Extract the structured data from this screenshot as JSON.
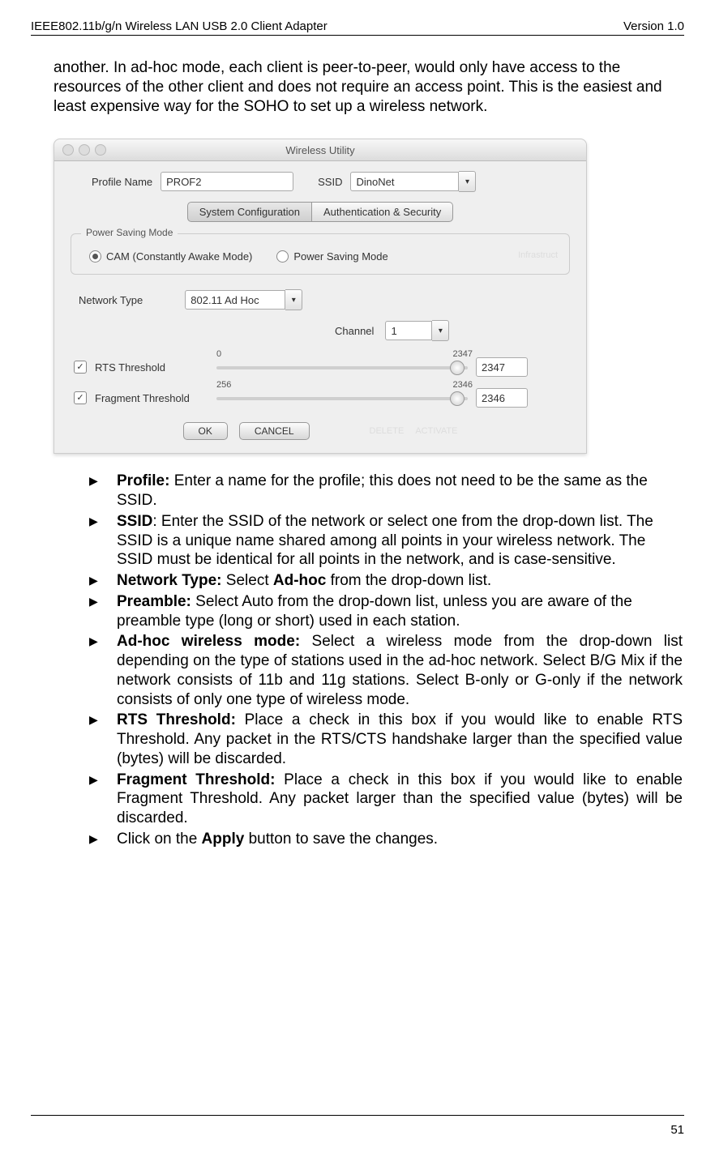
{
  "header": {
    "left": "IEEE802.11b/g/n Wireless LAN USB 2.0 Client Adapter",
    "right": "Version 1.0"
  },
  "intro_paragraph": "another.  In ad-hoc mode, each client is peer-to-peer, would only have access to the resources of the other client and does not require an access point. This is the easiest and least expensive way for the SOHO to set up a wireless network.",
  "screenshot": {
    "window_title": "Wireless Utility",
    "profile_label": "Profile Name",
    "profile_value": "PROF2",
    "ssid_label": "SSID",
    "ssid_value": "DinoNet",
    "tab_sys": "System Configuration",
    "tab_auth": "Authentication & Security",
    "psm_title": "Power Saving Mode",
    "psm_cam": "CAM (Constantly Awake Mode)",
    "psm_psm": "Power Saving Mode",
    "nettype_label": "Network Type",
    "nettype_value": "802.11 Ad Hoc",
    "channel_label": "Channel",
    "channel_value": "1",
    "rts_label": "RTS Threshold",
    "rts_min": "0",
    "rts_max": "2347",
    "rts_value": "2347",
    "frag_label": "Fragment Threshold",
    "frag_min": "256",
    "frag_max": "2346",
    "frag_value": "2346",
    "ok": "OK",
    "cancel": "CANCEL",
    "ghost_delete": "DELETE",
    "ghost_activate": "ACTIVATE",
    "ghost_infra": "Infrastruct"
  },
  "bullets": [
    {
      "bold": "Profile:",
      "rest": " Enter a name for the profile; this does not need to be the same as the SSID.",
      "justify": false
    },
    {
      "bold": "SSID",
      "rest": ": Enter the SSID of the network or select one from the drop-down list. The SSID is a unique name shared among all points in your wireless network. The SSID must be identical for all points in the network, and is case-sensitive.",
      "justify": false
    },
    {
      "bold": "Network Type:",
      "rest": " Select ",
      "bold2": "Ad-hoc",
      "rest2": " from the drop-down list.",
      "justify": false
    },
    {
      "bold": "Preamble:",
      "rest": " Select Auto from the drop-down list, unless you are aware of the preamble type (long or short) used in each station.",
      "justify": false
    },
    {
      "bold": "Ad-hoc wireless mode:",
      "rest": " Select a wireless mode from the drop-down list depending on the type of stations used in the ad-hoc network. Select B/G Mix if the network consists of 11b and 11g stations. Select B-only or G-only if the network consists of only one type of wireless mode.",
      "justify": true
    },
    {
      "bold": "RTS Threshold:",
      "rest": " Place a check in this box if you would like to enable RTS Threshold. Any packet in the RTS/CTS handshake larger than the specified value (bytes) will be discarded.",
      "justify": true
    },
    {
      "bold": "Fragment Threshold:",
      "rest": " Place a check in this box if you would like to enable Fragment Threshold. Any packet larger than the specified value (bytes) will be discarded.",
      "justify": true
    },
    {
      "plain1": "Click on the ",
      "bold": "Apply",
      "rest": " button to save the changes.",
      "justify": false
    }
  ],
  "footer": {
    "page": "51"
  }
}
